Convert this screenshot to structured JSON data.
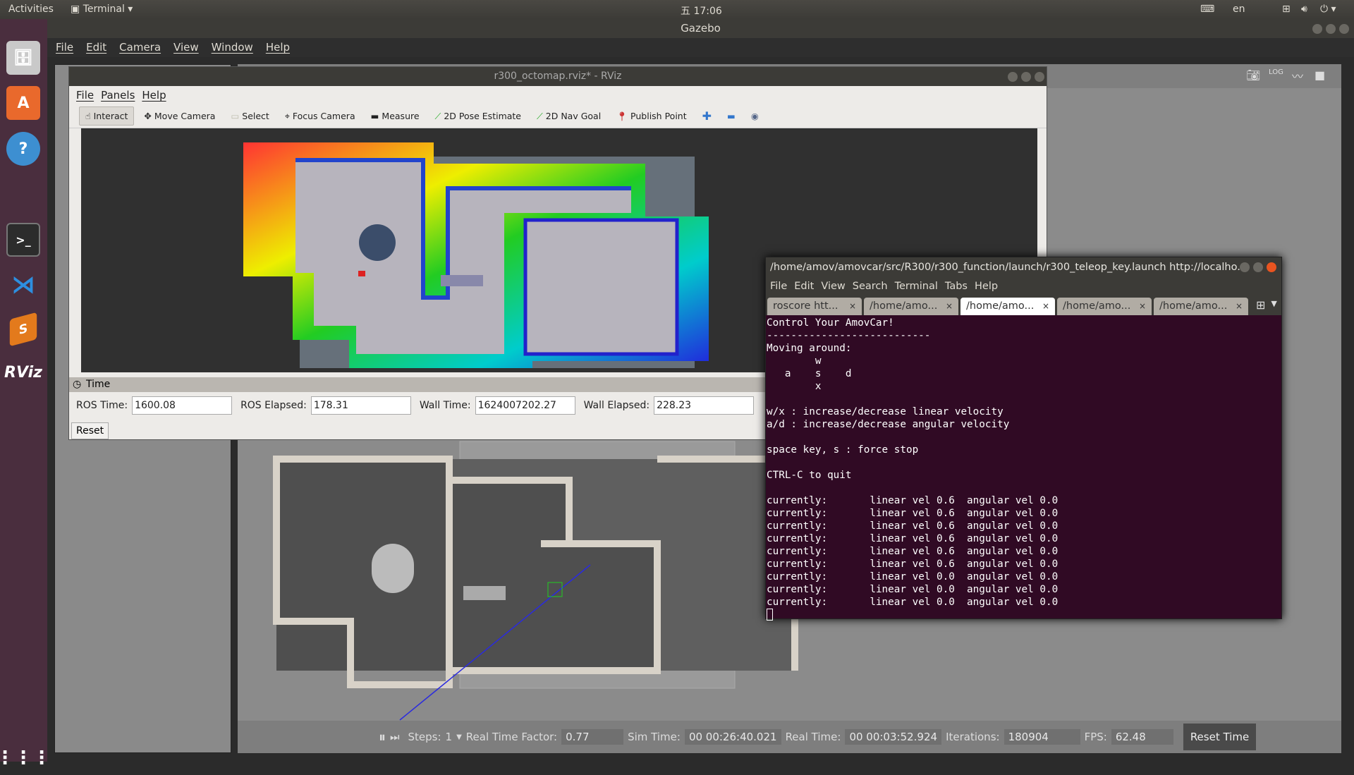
{
  "topbar": {
    "activities": "Activities",
    "app": "Terminal",
    "clock": "五 17:06",
    "lang": "en"
  },
  "launcher": [
    "files-icon",
    "software-center-icon",
    "help-icon",
    "terminal-icon",
    "vscode-icon",
    "sublime-icon",
    "rviz-icon",
    "app-grid-icon"
  ],
  "launcher_labels": {
    "rviz": "RViz"
  },
  "gazebo": {
    "title": "Gazebo",
    "menu": [
      "File",
      "Edit",
      "Camera",
      "View",
      "Window",
      "Help"
    ],
    "bottom": {
      "steps_label": "Steps:",
      "steps": "1",
      "rtf_label": "Real Time Factor:",
      "rtf": "0.77",
      "sim_label": "Sim Time:",
      "sim": "00 00:26:40.021",
      "real_label": "Real Time:",
      "real": "00 00:03:52.924",
      "iter_label": "Iterations:",
      "iter": "180904",
      "fps_label": "FPS:",
      "fps": "62.48",
      "reset": "Reset Time"
    }
  },
  "rviz": {
    "title": "r300_octomap.rviz* - RViz",
    "menu": [
      "File",
      "Panels",
      "Help"
    ],
    "tools": [
      "Interact",
      "Move Camera",
      "Select",
      "Focus Camera",
      "Measure",
      "2D Pose Estimate",
      "2D Nav Goal",
      "Publish Point"
    ],
    "time": {
      "header": "Time",
      "ros_time_label": "ROS Time:",
      "ros_time": "1600.08",
      "ros_elapsed_label": "ROS Elapsed:",
      "ros_elapsed": "178.31",
      "wall_time_label": "Wall Time:",
      "wall_time": "1624007202.27",
      "wall_elapsed_label": "Wall Elapsed:",
      "wall_elapsed": "228.23",
      "reset": "Reset"
    }
  },
  "terminal": {
    "title": "/home/amov/amovcar/src/R300/r300_function/launch/r300_teleop_key.launch http://localho...",
    "menu": [
      "File",
      "Edit",
      "View",
      "Search",
      "Terminal",
      "Tabs",
      "Help"
    ],
    "tabs": [
      "roscore htt...",
      "/home/amo...",
      "/home/amo...",
      "/home/amo...",
      "/home/amo..."
    ],
    "active_tab": 2,
    "output": "Control Your AmovCar!\n---------------------------\nMoving around:\n        w\n   a    s    d\n        x\n\nw/x : increase/decrease linear velocity\na/d : increase/decrease angular velocity\n\nspace key, s : force stop\n\nCTRL-C to quit\n\ncurrently:\t linear vel 0.6\t angular vel 0.0\ncurrently:\t linear vel 0.6\t angular vel 0.0\ncurrently:\t linear vel 0.6\t angular vel 0.0\ncurrently:\t linear vel 0.6\t angular vel 0.0\ncurrently:\t linear vel 0.6\t angular vel 0.0\ncurrently:\t linear vel 0.6\t angular vel 0.0\ncurrently:\t linear vel 0.0\t angular vel 0.0\ncurrently:\t linear vel 0.0\t angular vel 0.0\ncurrently:\t linear vel 0.0\t angular vel 0.0"
  }
}
